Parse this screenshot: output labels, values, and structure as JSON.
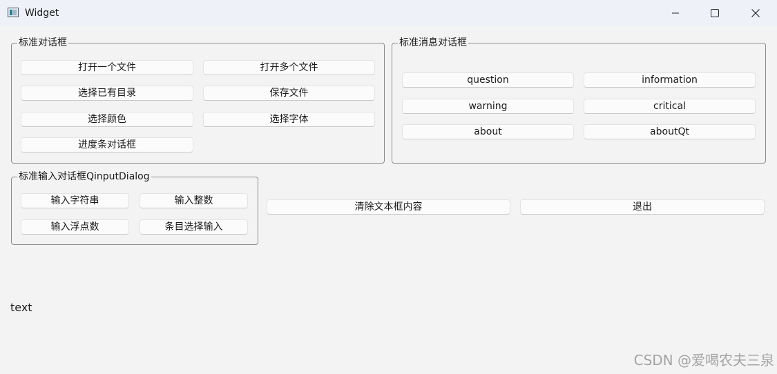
{
  "window": {
    "title": "Widget",
    "icon": "app-window-icon"
  },
  "controls": {
    "minimize": "minimize-icon",
    "maximize": "maximize-icon",
    "close": "close-icon"
  },
  "std_dialogs": {
    "title": "标准对话框",
    "open_file": "打开一个文件",
    "open_files": "打开多个文件",
    "select_dir": "选择已有目录",
    "save_file": "保存文件",
    "select_color": "选择颜色",
    "select_font": "选择字体",
    "progress_dialog": "进度条对话框"
  },
  "message_boxes": {
    "title": "标准消息对话框",
    "question": "question",
    "information": "information",
    "warning": "warning",
    "critical": "critical",
    "about": "about",
    "aboutqt": "aboutQt"
  },
  "input_dialogs": {
    "title": "标准输入对话框QinputDialog",
    "input_string": "输入字符串",
    "input_int": "输入整数",
    "input_float": "输入浮点数",
    "input_item": "条目选择输入"
  },
  "actions": {
    "clear_text": "清除文本框内容",
    "exit": "退出"
  },
  "output_text": "text",
  "watermark": "CSDN @爱喝农夫三泉"
}
